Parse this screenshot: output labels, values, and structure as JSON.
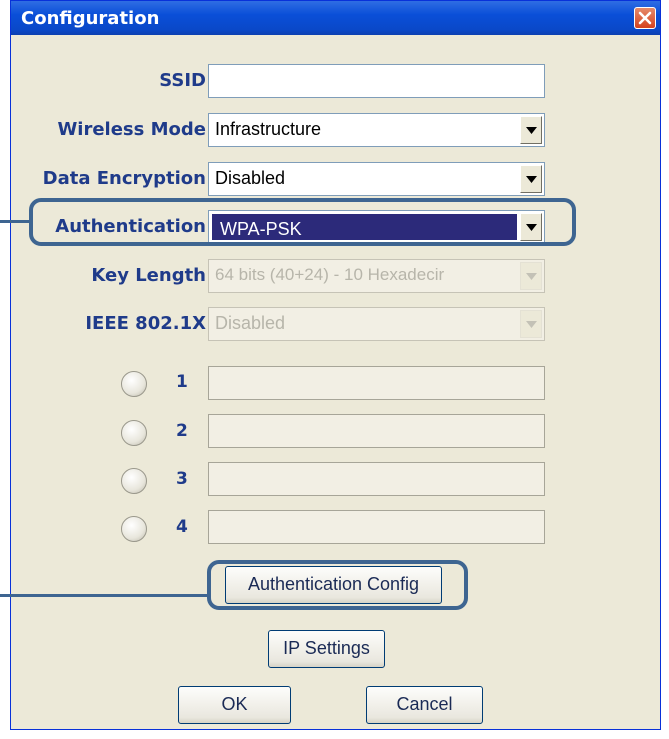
{
  "window": {
    "title": "Configuration"
  },
  "fields": {
    "ssid": {
      "label": "SSID",
      "value": ""
    },
    "wireless_mode": {
      "label": "Wireless Mode",
      "value": "Infrastructure"
    },
    "data_encryption": {
      "label": "Data Encryption",
      "value": "Disabled"
    },
    "authentication": {
      "label": "Authentication",
      "value": "WPA-PSK"
    },
    "key_length": {
      "label": "Key Length",
      "value": "64 bits (40+24) - 10 Hexadecir"
    },
    "ieee8021x": {
      "label": "IEEE 802.1X",
      "value": "Disabled"
    }
  },
  "keys": [
    {
      "number": "1",
      "value": ""
    },
    {
      "number": "2",
      "value": ""
    },
    {
      "number": "3",
      "value": ""
    },
    {
      "number": "4",
      "value": ""
    }
  ],
  "buttons": {
    "auth_config": "Authentication Config",
    "ip_settings": "IP Settings",
    "ok": "OK",
    "cancel": "Cancel"
  },
  "icons": {
    "close": "close-icon",
    "dropdown": "chevron-down-icon"
  },
  "colors": {
    "title_bar": "#0a4fd8",
    "callout": "#3e6591",
    "selection": "#2c2a7a",
    "label": "#1f3b8a"
  }
}
